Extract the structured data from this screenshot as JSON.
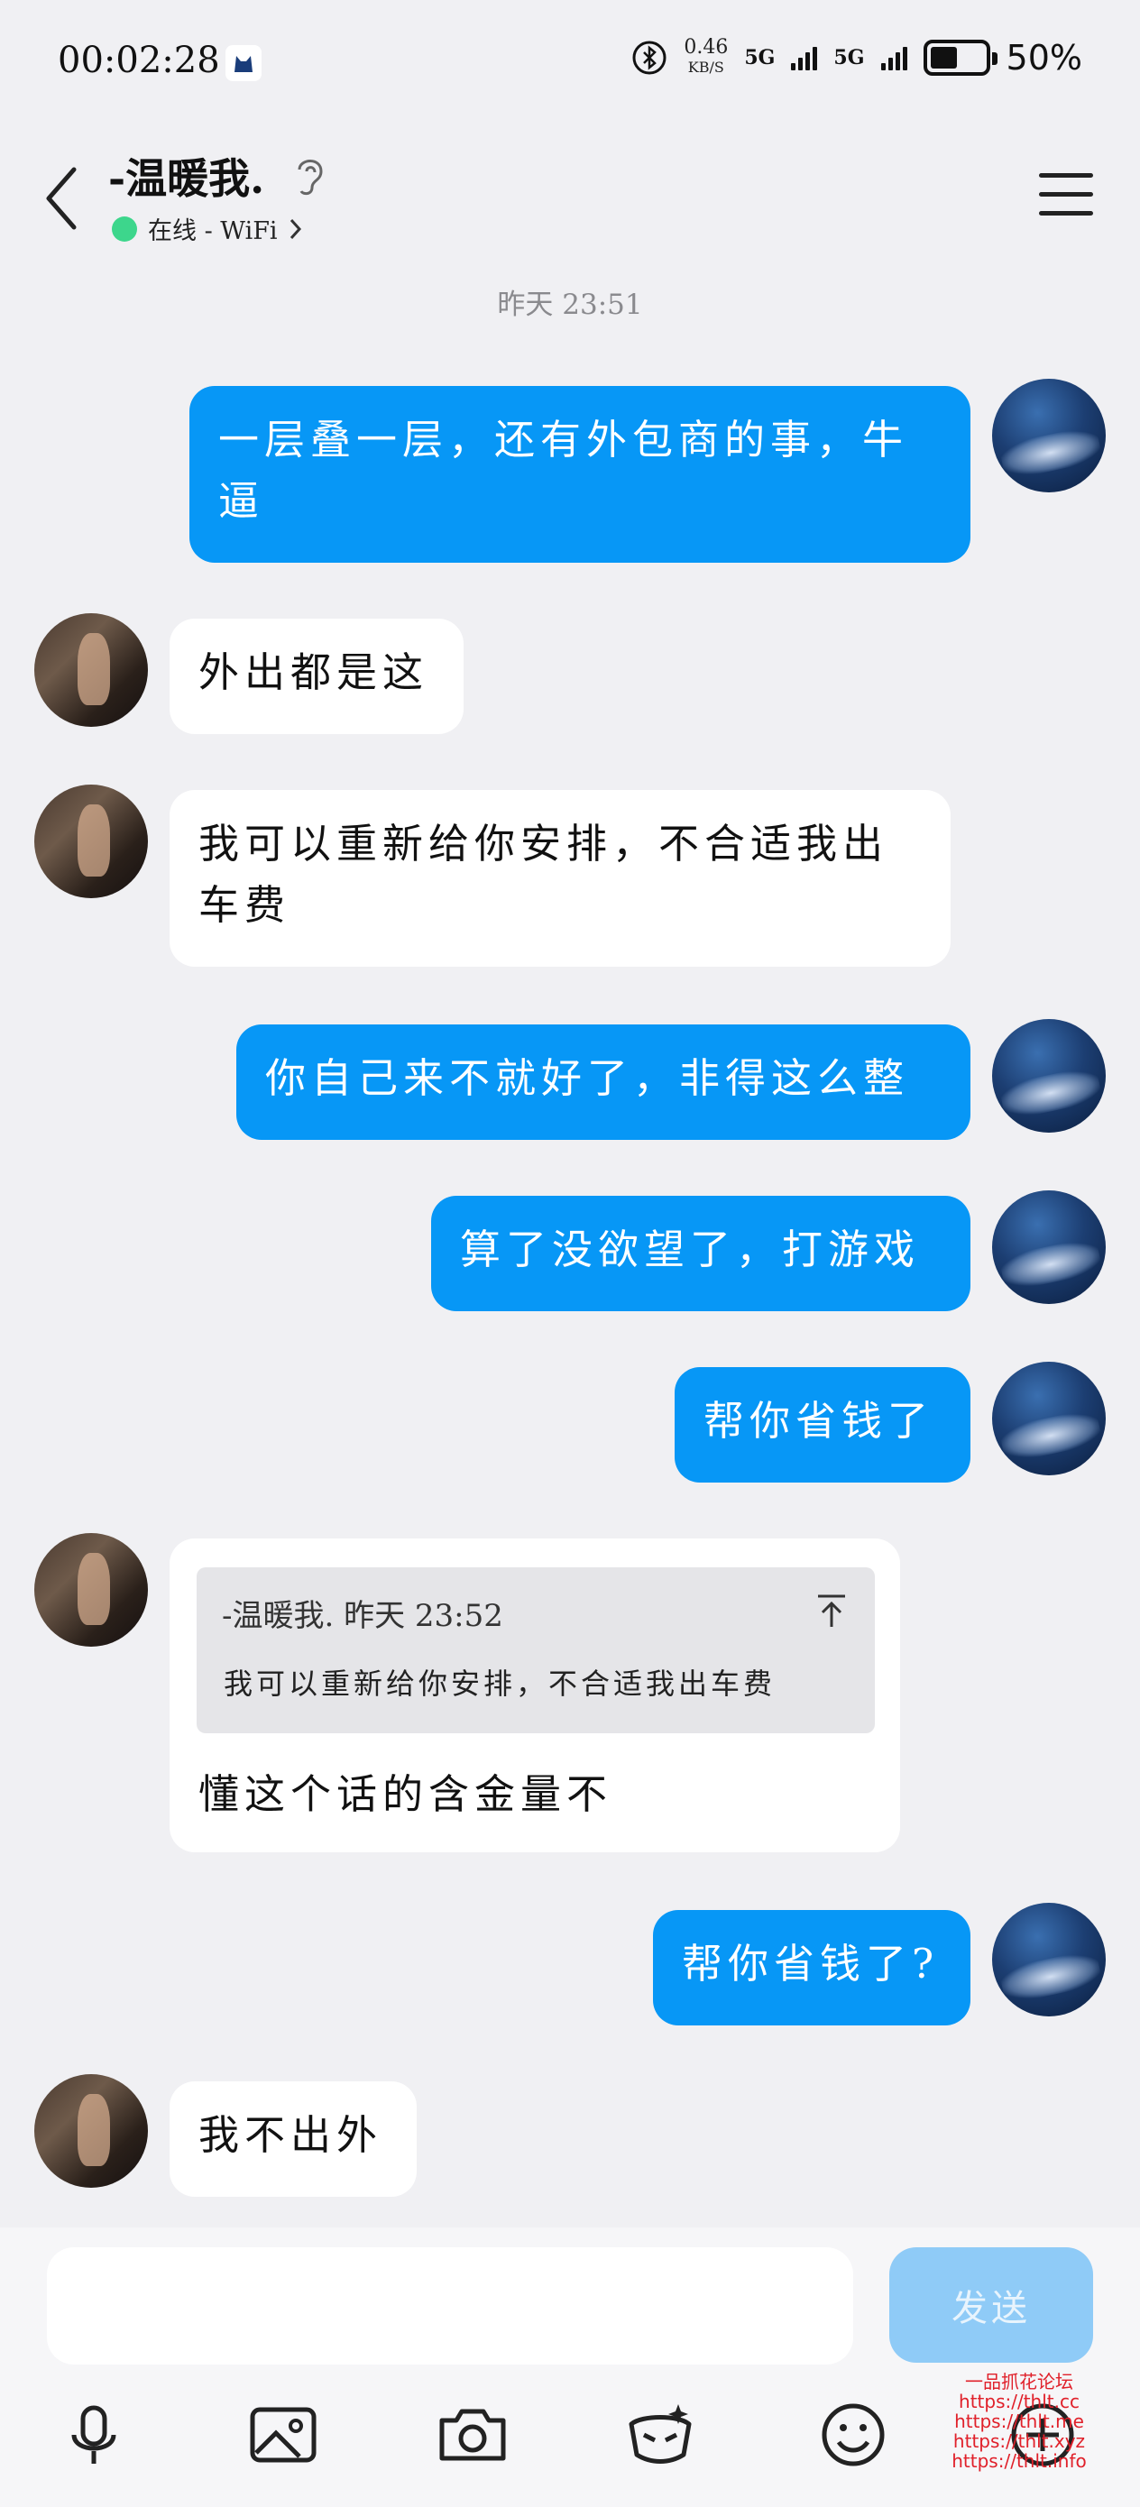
{
  "status_bar": {
    "time": "00:02:28",
    "net_speed_value": "0.46",
    "net_speed_unit": "KB/S",
    "signal1": "5G",
    "signal2": "5G",
    "battery_percent": "50%",
    "battery_level": 0.5
  },
  "header": {
    "title": "-温暖我.",
    "status": "在线 - WiFi"
  },
  "timestamp": "昨天 23:51",
  "messages": [
    {
      "from": "me",
      "text": "一层叠一层，还有外包商的事，牛逼"
    },
    {
      "from": "her",
      "text": "外出都是这"
    },
    {
      "from": "her",
      "text": "我可以重新给你安排，不合适我出车费"
    },
    {
      "from": "me",
      "text": "你自己来不就好了，非得这么整"
    },
    {
      "from": "me",
      "text": "算了没欲望了，打游戏"
    },
    {
      "from": "me",
      "text": "帮你省钱了"
    },
    {
      "from": "her",
      "text": "懂这个话的含金量不",
      "quote": {
        "head": "-温暖我. 昨天 23:52",
        "body": "我可以重新给你安排，不合适我出车费"
      }
    },
    {
      "from": "me",
      "text": "帮你省钱了?"
    },
    {
      "from": "her",
      "text": "我不出外"
    }
  ],
  "composer": {
    "input_value": "",
    "send_label": "发送"
  },
  "toolbar_icons": [
    "microphone-icon",
    "image-icon",
    "camera-icon",
    "red-packet-icon",
    "emoji-icon",
    "plus-icon"
  ],
  "watermark": [
    "一品抓花论坛",
    "https://thlt.cc",
    "https://thlt.me",
    "https://thlt.xyz",
    "https://thlt.info"
  ],
  "colors": {
    "my_bubble": "#0797f6",
    "her_bubble": "#ffffff",
    "background": "#f0f0f3",
    "online_dot": "#3dd68c",
    "send_button": "#8fcbf7"
  }
}
